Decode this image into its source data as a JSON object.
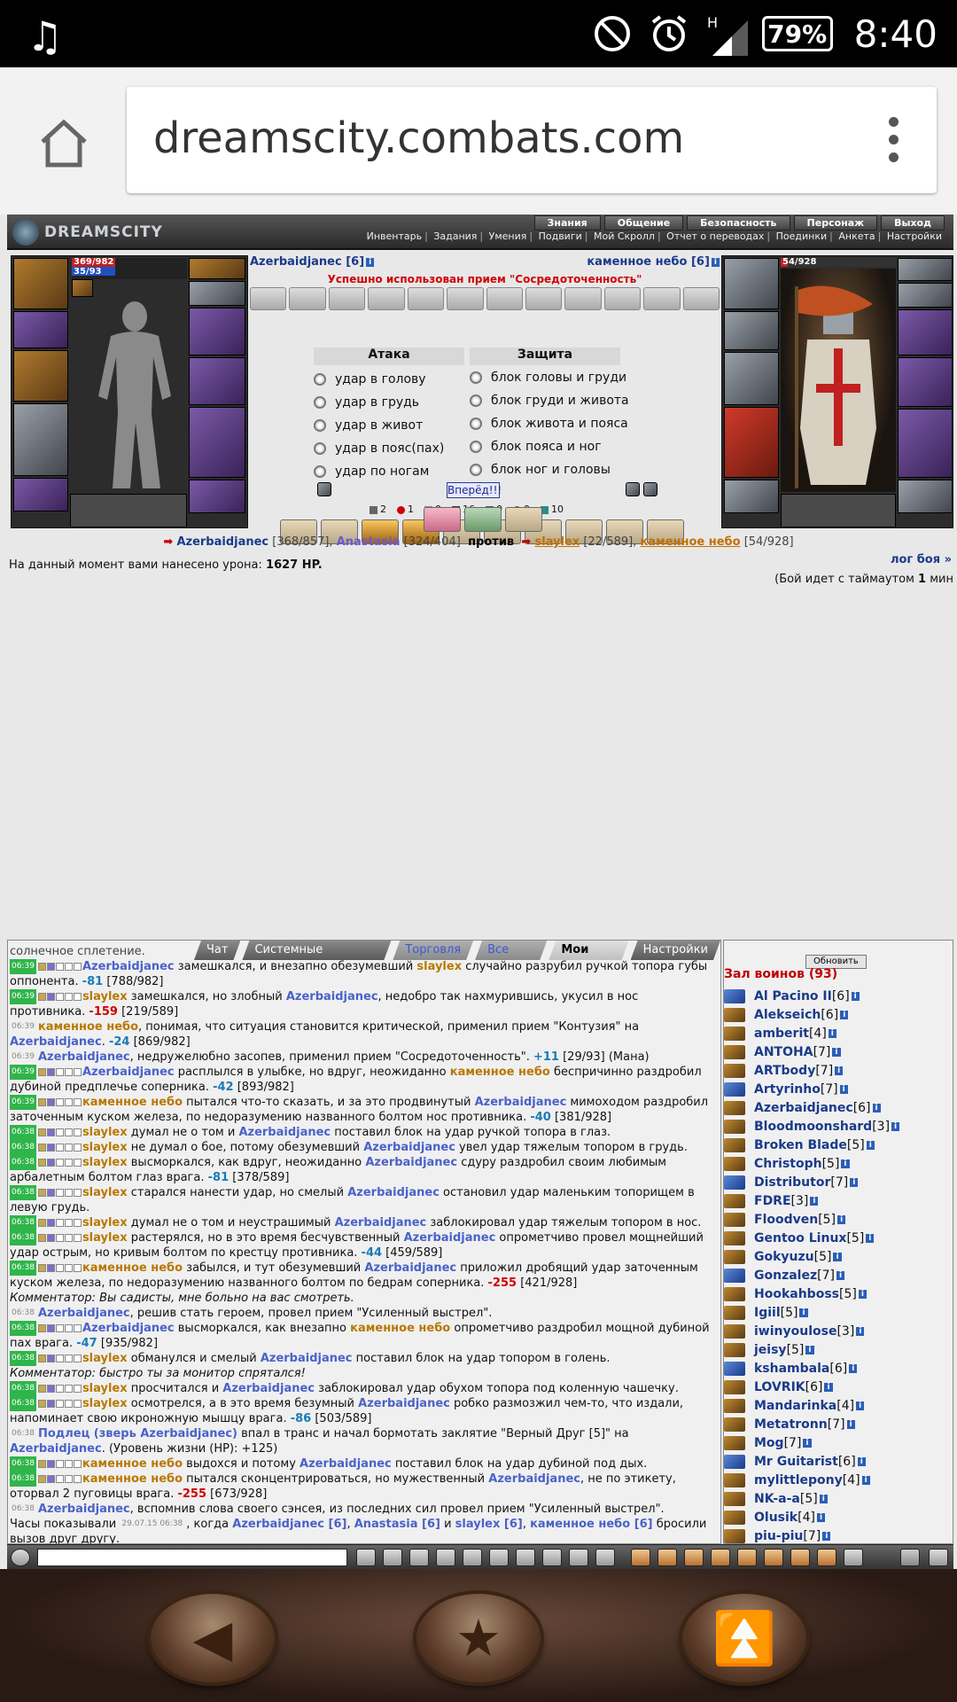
{
  "statusbar": {
    "battery": "79%",
    "time": "8:40",
    "net": "H"
  },
  "browser": {
    "url": "dreamscity.combats.com"
  },
  "topnav": {
    "logo": "DREAMSCITY",
    "primary": [
      "Знания",
      "Общение",
      "Безопасность",
      "Персонаж",
      "Выход"
    ],
    "secondary": [
      "Инвентарь",
      "Задания",
      "Умения",
      "Подвиги",
      "Мой Скролл",
      "Отчет о переводах",
      "Поединки",
      "Анкета",
      "Настройки"
    ]
  },
  "left_char": {
    "hp": "369/982",
    "mana": "35/93"
  },
  "right_char": {
    "hp": "54/928"
  },
  "battle": {
    "player_left": "Azerbaidjanec [6]",
    "player_right": "каменное небо [6]",
    "success_msg": "Успешно использован прием \"Сосредоточенность\"",
    "attack_title": "Атака",
    "defense_title": "Защита",
    "attacks": [
      "удар в голову",
      "удар в грудь",
      "удар в живот",
      "удар в пояс(пах)",
      "удар по ногам"
    ],
    "defenses": [
      "блок головы и груди",
      "блок груди и живота",
      "блок живота и пояса",
      "блок пояса и ног",
      "блок ног и головы"
    ],
    "go_label": "Вперёд!!!",
    "stats": [
      "2",
      "1",
      "0",
      "16",
      "0",
      "0",
      "10"
    ]
  },
  "vs": {
    "a1": "Azerbaidjanec",
    "a1_hp": "[368/857],",
    "a2": "Anastasia",
    "a2_hp": "[324/404]",
    "vs_word": "против",
    "b1": "slaylex",
    "b1_hp": "[22/589],",
    "b2": "каменное небо",
    "b2_hp": "[54/928]"
  },
  "damage_line": {
    "pre": "На данный момент вами нанесено урона:",
    "value": "1627 HP."
  },
  "log_link": "лог боя »",
  "timeout_line": {
    "pre": "(Бой идет с таймаутом",
    "num": "1",
    "post": "мин"
  },
  "chat_tabs": [
    "Чат",
    "Системные сообщения",
    "Торговля",
    "Все логи",
    "Мои логи",
    "Настройки"
  ],
  "chat_top": "солнечное сплетение.",
  "chat": [
    {
      "t": "06:39",
      "parts": [
        [
          "b",
          "Azerbaidjanec"
        ],
        [
          "x",
          " замешкался, и внезапно обезумевший "
        ],
        [
          "o",
          "slaylex"
        ],
        [
          "x",
          " случайно разрубил ручкой топора губы оппонента. "
        ],
        [
          "h",
          "-81"
        ],
        [
          "x",
          " [788/982]"
        ]
      ]
    },
    {
      "t": "06:39",
      "parts": [
        [
          "o",
          "slaylex"
        ],
        [
          "x",
          " замешкался, но злобный "
        ],
        [
          "b",
          "Azerbaidjanec"
        ],
        [
          "x",
          ", недобро так нахмурившись, укусил в нос противника. "
        ],
        [
          "d",
          "-159"
        ],
        [
          "x",
          " [219/589]"
        ]
      ]
    },
    {
      "t": "06:39",
      "plain": true,
      "parts": [
        [
          "o",
          "каменное небо"
        ],
        [
          "x",
          ", понимая, что ситуация становится критической, применил прием \"Контузия\" на "
        ],
        [
          "b",
          "Azerbaidjanec"
        ],
        [
          "x",
          ". "
        ],
        [
          "h",
          "-24"
        ],
        [
          "x",
          " [869/982]"
        ]
      ]
    },
    {
      "t": "06:39",
      "plain": true,
      "parts": [
        [
          "b",
          "Azerbaidjanec"
        ],
        [
          "x",
          ", недружелюбно засопев, применил прием \"Сосредоточенность\". "
        ],
        [
          "h",
          "+11"
        ],
        [
          "x",
          " [29/93] (Мана)"
        ]
      ]
    },
    {
      "t": "06:39",
      "parts": [
        [
          "b",
          "Azerbaidjanec"
        ],
        [
          "x",
          " расплылся в улыбке, но вдруг, неожиданно "
        ],
        [
          "o",
          "каменное небо"
        ],
        [
          "x",
          " беспричинно раздробил дубиной предплечье соперника. "
        ],
        [
          "h",
          "-42"
        ],
        [
          "x",
          " [893/982]"
        ]
      ]
    },
    {
      "t": "06:39",
      "parts": [
        [
          "o",
          "каменное небо"
        ],
        [
          "x",
          " пытался что-то сказать, и за это продвинутый "
        ],
        [
          "b",
          "Azerbaidjanec"
        ],
        [
          "x",
          " мимоходом раздробил заточенным куском железа, по недоразумению названного болтом нос противника. "
        ],
        [
          "h",
          "-40"
        ],
        [
          "x",
          " [381/928]"
        ]
      ]
    },
    {
      "t": "06:38",
      "parts": [
        [
          "o",
          "slaylex"
        ],
        [
          "x",
          " думал не о том и "
        ],
        [
          "b",
          "Azerbaidjanec"
        ],
        [
          "x",
          " поставил блок на удар ручкой топора в глаз."
        ]
      ]
    },
    {
      "t": "06:38",
      "parts": [
        [
          "o",
          "slaylex"
        ],
        [
          "x",
          " не думал о бое, потому обезумевший "
        ],
        [
          "b",
          "Azerbaidjanec"
        ],
        [
          "x",
          " увел удар тяжелым топором в грудь."
        ]
      ]
    },
    {
      "t": "06:38",
      "parts": [
        [
          "o",
          "slaylex"
        ],
        [
          "x",
          " высморкался, как вдруг, неожиданно "
        ],
        [
          "b",
          "Azerbaidjanec"
        ],
        [
          "x",
          " сдуру раздробил своим любимым арбалетным болтом глаз врага. "
        ],
        [
          "h",
          "-81"
        ],
        [
          "x",
          " [378/589]"
        ]
      ]
    },
    {
      "t": "06:38",
      "parts": [
        [
          "o",
          "slaylex"
        ],
        [
          "x",
          " старался нанести удар, но смелый "
        ],
        [
          "b",
          "Azerbaidjanec"
        ],
        [
          "x",
          " остановил удар маленьким топорищем в левую грудь."
        ]
      ]
    },
    {
      "t": "06:38",
      "parts": [
        [
          "o",
          "slaylex"
        ],
        [
          "x",
          " думал не о том и неустрашимый "
        ],
        [
          "b",
          "Azerbaidjanec"
        ],
        [
          "x",
          " заблокировал удар тяжелым топором в нос."
        ]
      ]
    },
    {
      "t": "06:38",
      "parts": [
        [
          "o",
          "slaylex"
        ],
        [
          "x",
          " растерялся, но в это время бесчувственный "
        ],
        [
          "b",
          "Azerbaidjanec"
        ],
        [
          "x",
          " опрометчиво провел мощнейший удар острым, но кривым болтом по крестцу противника. "
        ],
        [
          "h",
          "-44"
        ],
        [
          "x",
          " [459/589]"
        ]
      ]
    },
    {
      "t": "06:38",
      "parts": [
        [
          "o",
          "каменное небо"
        ],
        [
          "x",
          " забылся, и тут обезумевший "
        ],
        [
          "b",
          "Azerbaidjanec"
        ],
        [
          "x",
          " приложил дробящий удар заточенным куском железа, по недоразумению названного болтом по бедрам соперника. "
        ],
        [
          "d",
          "-255"
        ],
        [
          "x",
          " [421/928]"
        ]
      ]
    },
    {
      "t": "",
      "parts": [
        [
          "i",
          "Комментатор: Вы садисты, мне больно на вас смотреть."
        ]
      ]
    },
    {
      "t": "06:38",
      "plain": true,
      "parts": [
        [
          "b",
          "Azerbaidjanec"
        ],
        [
          "x",
          ", решив стать героем, провел прием \"Усиленный выстрел\"."
        ]
      ]
    },
    {
      "t": "06:38",
      "parts": [
        [
          "b",
          "Azerbaidjanec"
        ],
        [
          "x",
          " высморкался, как внезапно "
        ],
        [
          "o",
          "каменное небо"
        ],
        [
          "x",
          " опрометчиво раздробил мощной дубиной пах врага. "
        ],
        [
          "h",
          "-47"
        ],
        [
          "x",
          " [935/982]"
        ]
      ]
    },
    {
      "t": "06:38",
      "parts": [
        [
          "o",
          "slaylex"
        ],
        [
          "x",
          " обманулся и смелый "
        ],
        [
          "b",
          "Azerbaidjanec"
        ],
        [
          "x",
          " поставил блок на удар топором в голень."
        ]
      ]
    },
    {
      "t": "",
      "parts": [
        [
          "i",
          "Комментатор: быстро ты за монитор спрятался!"
        ]
      ]
    },
    {
      "t": "06:38",
      "parts": [
        [
          "o",
          "slaylex"
        ],
        [
          "x",
          " просчитался и "
        ],
        [
          "b",
          "Azerbaidjanec"
        ],
        [
          "x",
          " заблокировал удар обухом топора под коленную чашечку."
        ]
      ]
    },
    {
      "t": "06:38",
      "parts": [
        [
          "o",
          "slaylex"
        ],
        [
          "x",
          " осмотрелся, а в это время безумный "
        ],
        [
          "b",
          "Azerbaidjanec"
        ],
        [
          "x",
          " робко размозжил чем-то, что издали, напоминает свою икроножную мышцу врага. "
        ],
        [
          "h",
          "-86"
        ],
        [
          "x",
          " [503/589]"
        ]
      ]
    },
    {
      "t": "06:38",
      "plain": true,
      "parts": [
        [
          "b",
          "Подлец (зверь Azerbaidjanec)"
        ],
        [
          "x",
          " впал в транс и начал бормотать заклятие \"Верный Друг [5]\" на "
        ],
        [
          "b",
          "Azerbaidjanec"
        ],
        [
          "x",
          ". (Уровень жизни (HP): +125)"
        ]
      ]
    },
    {
      "t": "06:38",
      "parts": [
        [
          "o",
          "каменное небо"
        ],
        [
          "x",
          " выдохся и потому "
        ],
        [
          "b",
          "Azerbaidjanec"
        ],
        [
          "x",
          " поставил блок на удар дубиной под дых."
        ]
      ]
    },
    {
      "t": "06:38",
      "parts": [
        [
          "o",
          "каменное небо"
        ],
        [
          "x",
          " пытался сконцентрироваться, но мужественный "
        ],
        [
          "b",
          "Azerbaidjanec"
        ],
        [
          "x",
          ", не по этикету, оторвал 2 пуговицы врага. "
        ],
        [
          "d",
          "-255"
        ],
        [
          "x",
          " [673/928]"
        ]
      ]
    },
    {
      "t": "06:38",
      "plain": true,
      "parts": [
        [
          "b",
          "Azerbaidjanec"
        ],
        [
          "x",
          ", вспомнив слова своего сэнсея, из последних сил провел прием \"Усиленный выстрел\"."
        ]
      ]
    },
    {
      "t": "",
      "parts": [
        [
          "x",
          "Часы показывали "
        ],
        [
          "g",
          "29.07.15 06:38"
        ],
        [
          "x",
          ", когда "
        ],
        [
          "b",
          "Azerbaidjanec [6]"
        ],
        [
          "x",
          ", "
        ],
        [
          "b",
          "Anastasia [6]"
        ],
        [
          "x",
          " и "
        ],
        [
          "b",
          "slaylex [6]"
        ],
        [
          "x",
          ", "
        ],
        [
          "b",
          "каменное небо [6]"
        ],
        [
          "x",
          " бросили вызов друг другу."
        ]
      ]
    }
  ],
  "side": {
    "refresh": "Обновить",
    "hall": "Зал воинов (93)",
    "warriors": [
      {
        "n": "Al Pacino II",
        "l": "[6]"
      },
      {
        "n": "Alekseich",
        "l": "[6]"
      },
      {
        "n": "amberit",
        "l": "[4]"
      },
      {
        "n": "ANTOHA",
        "l": "[7]"
      },
      {
        "n": "ARTbody",
        "l": "[7]"
      },
      {
        "n": "Artyrinho",
        "l": "[7]"
      },
      {
        "n": "Azerbaidjanec",
        "l": "[6]"
      },
      {
        "n": "Bloodmoonshard",
        "l": "[3]"
      },
      {
        "n": "Broken Blade",
        "l": "[5]"
      },
      {
        "n": "Christoph",
        "l": "[5]"
      },
      {
        "n": "Distributor",
        "l": "[7]"
      },
      {
        "n": "FDRE",
        "l": "[3]"
      },
      {
        "n": "Floodven",
        "l": "[5]"
      },
      {
        "n": "Gentoo Linux",
        "l": "[5]"
      },
      {
        "n": "Gokyuzu",
        "l": "[5]"
      },
      {
        "n": "Gonzalez",
        "l": "[7]"
      },
      {
        "n": "Hookahboss",
        "l": "[5]"
      },
      {
        "n": "Igiil",
        "l": "[5]"
      },
      {
        "n": "iwinyoulose",
        "l": "[3]"
      },
      {
        "n": "jeisy",
        "l": "[5]"
      },
      {
        "n": "kshambala",
        "l": "[6]"
      },
      {
        "n": "LOVRIK",
        "l": "[6]"
      },
      {
        "n": "Mandarinka",
        "l": "[4]"
      },
      {
        "n": "Metatronn",
        "l": "[7]"
      },
      {
        "n": "Mog",
        "l": "[7]"
      },
      {
        "n": "Mr Guitarist",
        "l": "[6]"
      },
      {
        "n": "mylittlepony",
        "l": "[4]"
      },
      {
        "n": "NK-a-a",
        "l": "[5]"
      },
      {
        "n": "Olusik",
        "l": "[4]"
      },
      {
        "n": "piu-piu",
        "l": "[7]"
      }
    ]
  }
}
